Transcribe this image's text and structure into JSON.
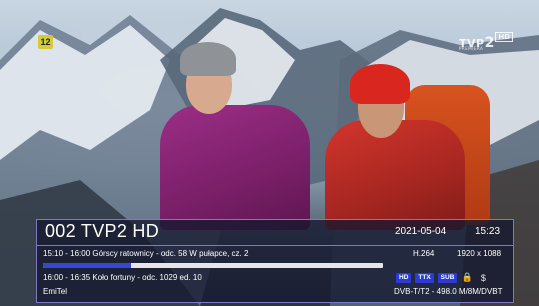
{
  "overlay": {
    "age_rating": "12",
    "channel_logo": {
      "brand": "TVP",
      "number": "2",
      "hd": "HD",
      "tag": "PREMIERA"
    }
  },
  "infobar": {
    "channel_title": "002 TVP2 HD",
    "date": "2021-05-04",
    "time": "15:23",
    "current_programme": "15:10 - 16:00  Górscy ratownicy - odc. 58 W pułapce, cz. 2",
    "progress": 0.26,
    "video_codec": "H.264",
    "resolution": "1920 x 1088",
    "next_programme": "16:00 - 16:35  Koło fortuny - odc. 1029 ed. 10",
    "flags": [
      "HD",
      "TTX",
      "SUB"
    ],
    "lock_icon": "lock-icon",
    "price_icon": "dollar-icon",
    "lock_glyph": "🔒",
    "price_glyph": "$",
    "provider": "EmiTel",
    "transponder": "DVB-T/T2 - 498.0 M/8M/DVBT"
  },
  "colors": {
    "panel_border": "#7d79c9",
    "flag_bg": "#2b3bd6",
    "progress_fill": "#3a47c8",
    "age_badge": "#d8c93a"
  }
}
